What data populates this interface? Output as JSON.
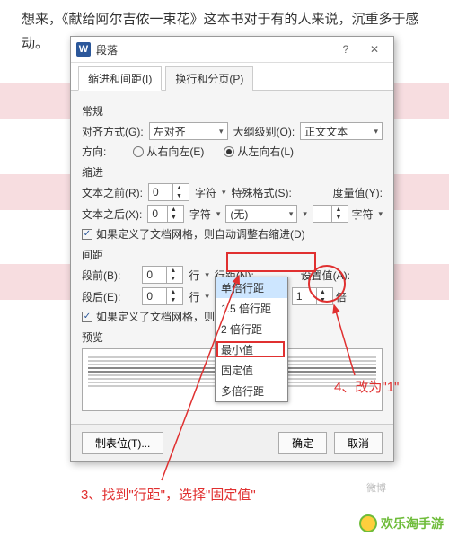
{
  "background_text": "想来，《献给阿尔吉侬一束花》这本书对于有的人来说，沉重多于感动。",
  "dialog": {
    "title": "段落",
    "tabs": {
      "indent": "缩进和间距(I)",
      "pagination": "换行和分页(P)"
    },
    "sections": {
      "general": "常规",
      "indent": "缩进",
      "spacing": "间距",
      "preview": "预览"
    },
    "labels": {
      "alignment": "对齐方式(G):",
      "outline": "大纲级别(O):",
      "direction": "方向:",
      "rtl": "从右向左(E)",
      "ltr": "从左向右(L)",
      "before_text": "文本之前(R):",
      "after_text": "文本之后(X):",
      "char_unit": "字符",
      "special": "特殊格式(S):",
      "indent_value": "度量值(Y):",
      "none_option": "(无)",
      "auto_indent": "如果定义了文档网格，则自动调整右缩进(D)",
      "space_before": "段前(B):",
      "space_after": "段后(E):",
      "line_unit": "行",
      "line_spacing": "行距(N):",
      "set_value": "设置值(A):",
      "snap_grid": "如果定义了文档网格，则与网格",
      "value_unit": "倍"
    },
    "values": {
      "alignment": "左对齐",
      "outline": "正文文本",
      "before_text": "0",
      "after_text": "0",
      "space_before": "0",
      "space_after": "0",
      "set_value": "1"
    },
    "dropdown_items": [
      "单倍行距",
      "单倍行距",
      "1.5 倍行距",
      "2 倍行距",
      "最小值",
      "固定值",
      "多倍行距"
    ],
    "buttons": {
      "tabs_btn": "制表位(T)...",
      "ok": "确定",
      "cancel": "取消"
    }
  },
  "annotations": {
    "step3": "3、找到\"行距\"，选择\"固定值\"",
    "step4": "4、改为\"1\""
  },
  "watermark": "欢乐淘手游"
}
